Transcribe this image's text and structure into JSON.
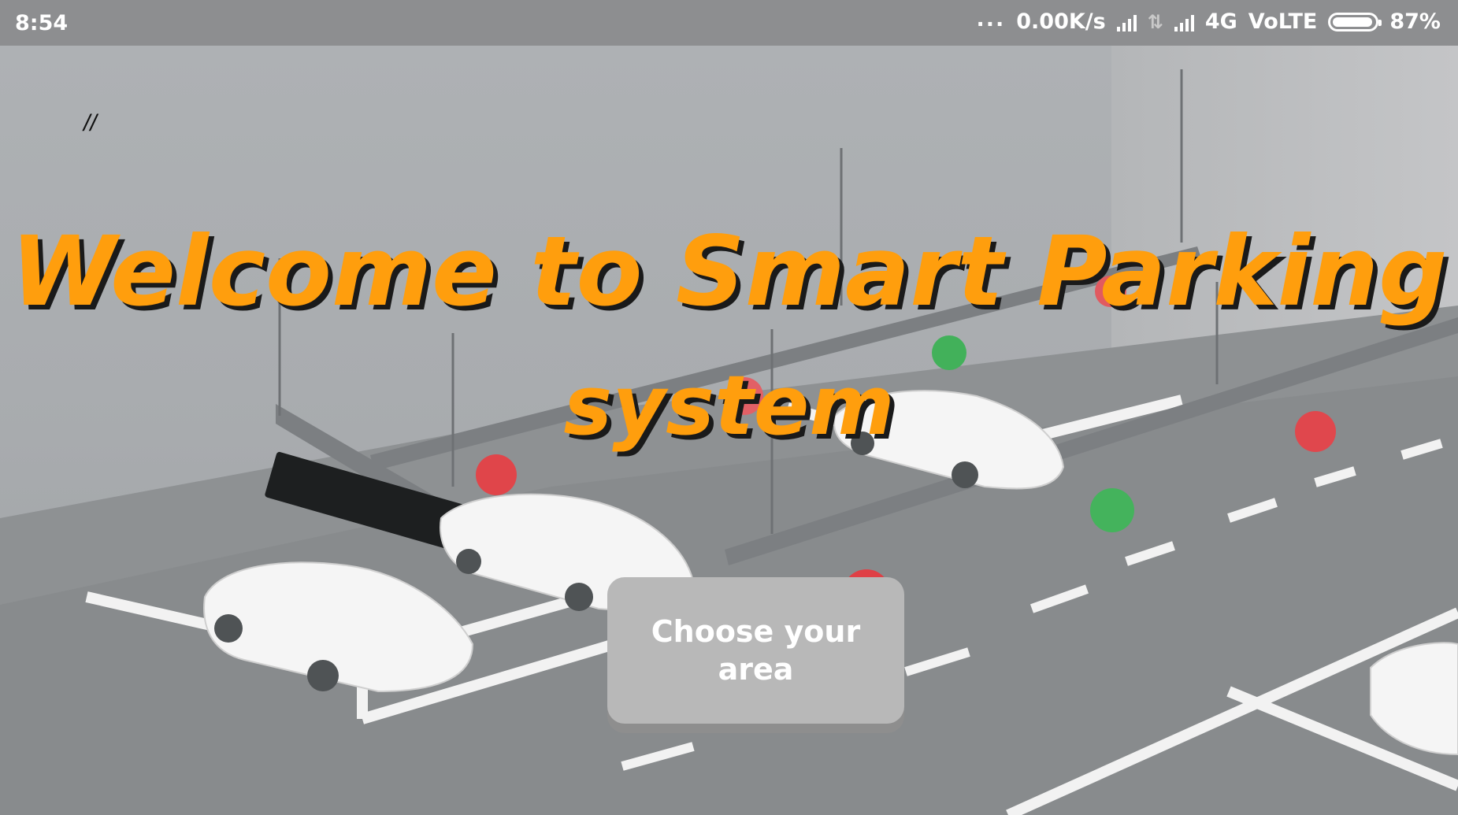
{
  "status_bar": {
    "time": "8:54",
    "dots": "...",
    "speed": "0.00K/s",
    "network": "4G",
    "volte": "VoLTE",
    "battery_percent": "87%"
  },
  "main": {
    "slash_mark": "//",
    "title_line1": "Welcome to Smart Parking",
    "title_line2": "system",
    "choose_button_label": "Choose your area"
  },
  "colors": {
    "title": "#ff9e0d",
    "button": "#b8b8b8",
    "status_bar": "#8d8e90"
  }
}
